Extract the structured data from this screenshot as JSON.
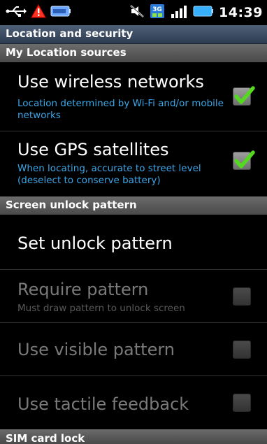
{
  "status_bar": {
    "time": "14:39",
    "icons": [
      "usb-icon",
      "warning-icon",
      "battery-monitor-icon",
      "mute-icon",
      "3g-icon",
      "signal-icon",
      "battery-icon"
    ]
  },
  "colors": {
    "title_bar": "#3a4a60",
    "section_header": "#5a5a5a",
    "summary_text": "#3aa6e8",
    "check_green": "#55d820"
  },
  "title_bar": {
    "title": "Location and security"
  },
  "sections": [
    {
      "header": "My Location sources",
      "items": [
        {
          "title": "Use wireless networks",
          "summary": "Location determined by Wi-Fi and/or mobile networks",
          "checked": true,
          "enabled": true
        },
        {
          "title": "Use GPS satellites",
          "summary": "When locating, accurate to street level (deselect to conserve battery)",
          "checked": true,
          "enabled": true
        }
      ]
    },
    {
      "header": "Screen unlock pattern",
      "items": [
        {
          "title": "Set unlock pattern",
          "enabled": true
        },
        {
          "title": "Require pattern",
          "summary": "Must draw pattern to unlock screen",
          "checked": false,
          "enabled": false
        },
        {
          "title": "Use visible pattern",
          "checked": false,
          "enabled": false
        },
        {
          "title": "Use tactile feedback",
          "checked": false,
          "enabled": false
        }
      ]
    },
    {
      "header": "SIM card lock"
    }
  ]
}
